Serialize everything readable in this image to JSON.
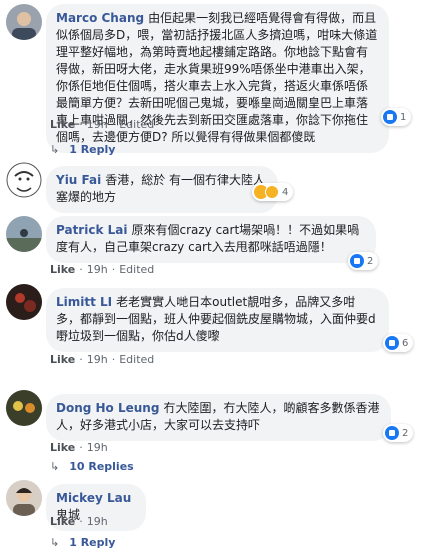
{
  "comments": [
    {
      "author": "Marco Chang",
      "text": "由佢起果一刻我已經唔覺得會有得做，而且似係個局多D，喂，當初話抒援北區人多擠迫嗎，咁味大條道理平整好幅地，為第時賣地起樓鋪定路路。你地諗下點會有得做，新田呀大佬，走水貨果班99%唔係坐中港車出入架，你係佢地佢住個嗎，搭火車去上水入完貨，搭返火車係唔係最簡單方便？去新田呢個己鬼城，要喺皇崗過關皇巴上車落車上車咁過關，然後先去到新田交匯處落車，你諗下你拖住個嗎，去邊便方便D? 所以覺得有得做果個都傻既",
      "like_label": "Like",
      "time": "19h",
      "edited": "Edited",
      "reaction_count": "1",
      "reply_label": "1 Reply"
    },
    {
      "author": "Yiu Fai",
      "text": "香港，総於 有一個冇律大陸人塞爆的地方",
      "reaction_count": "4"
    },
    {
      "author": "Patrick Lai",
      "text": "原來有個crazy cart場架喎！！不過如果喎度有人，自己車架crazy cart入去甩都咪話唔過隱！",
      "like_label": "Like",
      "time": "19h",
      "edited": "Edited",
      "reaction_count": "2"
    },
    {
      "author": "Limitt LI",
      "text": "老老實實人哋日本outlet靚咁多，品牌又多咁多，都靜到一個點，班人仲要起個銑皮屋購物城，入面仲要d嘢垃圾到一個點，你估d人傻嚟",
      "like_label": "Like",
      "time": "19h",
      "edited": "Edited",
      "reaction_count": "6"
    },
    {
      "author": "Dong Ho Leung",
      "text": "冇大陸圍，冇大陸人，啲顧客多數係香港人，好多港式小店，大家可以去支持吓",
      "like_label": "Like",
      "time": "19h",
      "reaction_count": "2",
      "reply_label": "10 Replies"
    },
    {
      "author": "Mickey Lau",
      "text": "鬼城",
      "like_label": "Like",
      "time": "19h",
      "reply_label": "1 Reply"
    }
  ],
  "colors": {
    "bubble": "#f2f3f5",
    "author": "#385898",
    "like": "#1877f2"
  }
}
